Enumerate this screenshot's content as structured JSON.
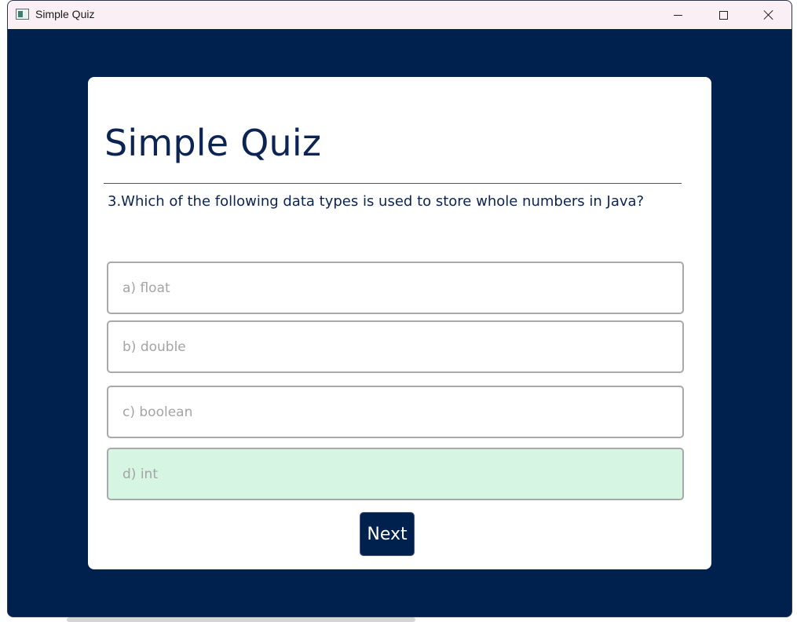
{
  "window": {
    "title": "Simple Quiz",
    "icons": {
      "app": "app-window-icon",
      "minimize": "minimize-icon",
      "maximize": "maximize-icon",
      "close": "close-icon"
    },
    "background_color": "#00204e",
    "titlebar_color": "#f9eff4"
  },
  "quiz": {
    "title": "Simple Quiz",
    "question": "3.Which of the following data types is used to store whole numbers in Java?",
    "options": [
      {
        "label": "a) float",
        "selected": false
      },
      {
        "label": "b) double",
        "selected": false
      },
      {
        "label": "c) boolean",
        "selected": false
      },
      {
        "label": "d) int",
        "selected": true
      }
    ],
    "next_label": "Next",
    "selected_color": "#d6f5e3",
    "accent_color": "#0b2454"
  }
}
